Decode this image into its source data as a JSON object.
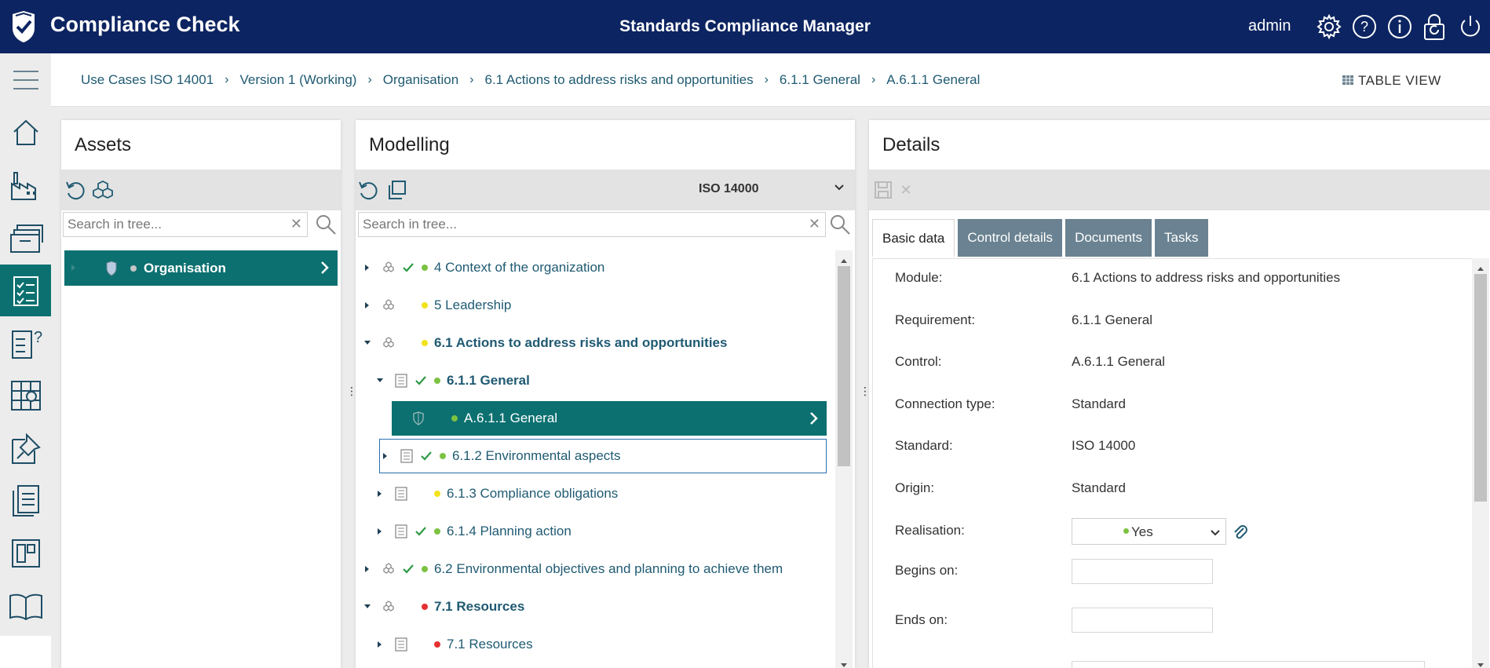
{
  "header": {
    "app_title": "Compliance Check",
    "center_title": "Standards Compliance Manager",
    "user": "admin",
    "icons": [
      "settings-gear-icon",
      "help-question-icon",
      "info-icon",
      "lock-refresh-icon",
      "power-icon"
    ]
  },
  "nav": {
    "items": [
      "menu-hamburger-icon",
      "home-icon",
      "factory-icon",
      "stacked-boxes-icon",
      "checklist-icon",
      "question-doc-icon",
      "grid-apps-icon",
      "pin-doc-icon",
      "documents-icon",
      "dashboard-icon",
      "book-icon"
    ],
    "active_index": 4
  },
  "breadcrumb": {
    "items": [
      "Use Cases ISO 14001",
      "Version 1 (Working)",
      "Organisation",
      "6.1 Actions to address risks and opportunities",
      "6.1.1 General",
      "A.6.1.1 General"
    ],
    "separator": ">"
  },
  "table_view": {
    "label": "TABLE VIEW",
    "enabled": false
  },
  "assets": {
    "title": "Assets",
    "search_placeholder": "Search in tree...",
    "tree": [
      {
        "label": "Organisation",
        "status": "grey",
        "selected": true
      }
    ]
  },
  "modelling": {
    "title": "Modelling",
    "standard": "ISO 14000",
    "search_placeholder": "Search in tree...",
    "tree": [
      {
        "label": "4 Context of the organization",
        "expand": "collapsed",
        "icon": "cluster",
        "check": true,
        "dot": "#7cc242",
        "bold": false,
        "indent": 0
      },
      {
        "label": "5 Leadership",
        "expand": "collapsed",
        "icon": "cluster",
        "check": false,
        "dot": "#f2e21a",
        "bold": false,
        "indent": 0
      },
      {
        "label": "6.1 Actions to address risks and opportunities",
        "expand": "expanded",
        "icon": "cluster",
        "check": false,
        "dot": "#f2e21a",
        "bold": true,
        "indent": 0
      },
      {
        "label": "6.1.1 General",
        "expand": "expanded",
        "icon": "doc",
        "check": true,
        "dot": "#7cc242",
        "bold": true,
        "indent": 1
      },
      {
        "label": "A.6.1.1 General",
        "expand": "none",
        "icon": "shield",
        "check": false,
        "dot": "#7cc242",
        "bold": false,
        "indent": 2,
        "selected": true
      },
      {
        "label": "6.1.2 Environmental aspects",
        "expand": "collapsed",
        "icon": "doc",
        "check": true,
        "dot": "#7cc242",
        "bold": false,
        "indent": 1,
        "focused": true
      },
      {
        "label": "6.1.3 Compliance obligations",
        "expand": "collapsed",
        "icon": "doc",
        "check": false,
        "dot": "#f2e21a",
        "bold": false,
        "indent": 1
      },
      {
        "label": "6.1.4 Planning action",
        "expand": "collapsed",
        "icon": "doc",
        "check": true,
        "dot": "#7cc242",
        "bold": false,
        "indent": 1
      },
      {
        "label": "6.2 Environmental objectives and planning to achieve them",
        "expand": "collapsed",
        "icon": "cluster",
        "check": true,
        "dot": "#7cc242",
        "bold": false,
        "indent": 0
      },
      {
        "label": "7.1 Resources",
        "expand": "expanded",
        "icon": "cluster",
        "check": false,
        "dot": "#e53030",
        "bold": true,
        "indent": 0
      },
      {
        "label": "7.1 Resources",
        "expand": "collapsed",
        "icon": "doc",
        "check": false,
        "dot": "#e53030",
        "bold": false,
        "indent": 1
      }
    ]
  },
  "details": {
    "title": "Details",
    "tabs": [
      "Basic data",
      "Control details",
      "Documents",
      "Tasks"
    ],
    "active_tab": 0,
    "fields": [
      {
        "label": "Module:",
        "value": "6.1 Actions to address risks and opportunities"
      },
      {
        "label": "Requirement:",
        "value": "6.1.1 General"
      },
      {
        "label": "Control:",
        "value": "A.6.1.1 General"
      },
      {
        "label": "Connection type:",
        "value": "Standard"
      },
      {
        "label": "Standard:",
        "value": "ISO 14000"
      },
      {
        "label": "Origin:",
        "value": "Standard"
      }
    ],
    "realisation": {
      "label": "Realisation:",
      "value": "Yes",
      "dot": "#7cc242"
    },
    "begins_on": {
      "label": "Begins on:",
      "value": ""
    },
    "ends_on": {
      "label": "Ends on:",
      "value": ""
    }
  },
  "colors": {
    "header_bg": "#0c2461",
    "accent_teal": "#0c7070",
    "link": "#1f5a72",
    "tab_inactive": "#6a8291",
    "status_green": "#7cc242",
    "status_yellow": "#f2e21a",
    "status_red": "#e53030"
  }
}
